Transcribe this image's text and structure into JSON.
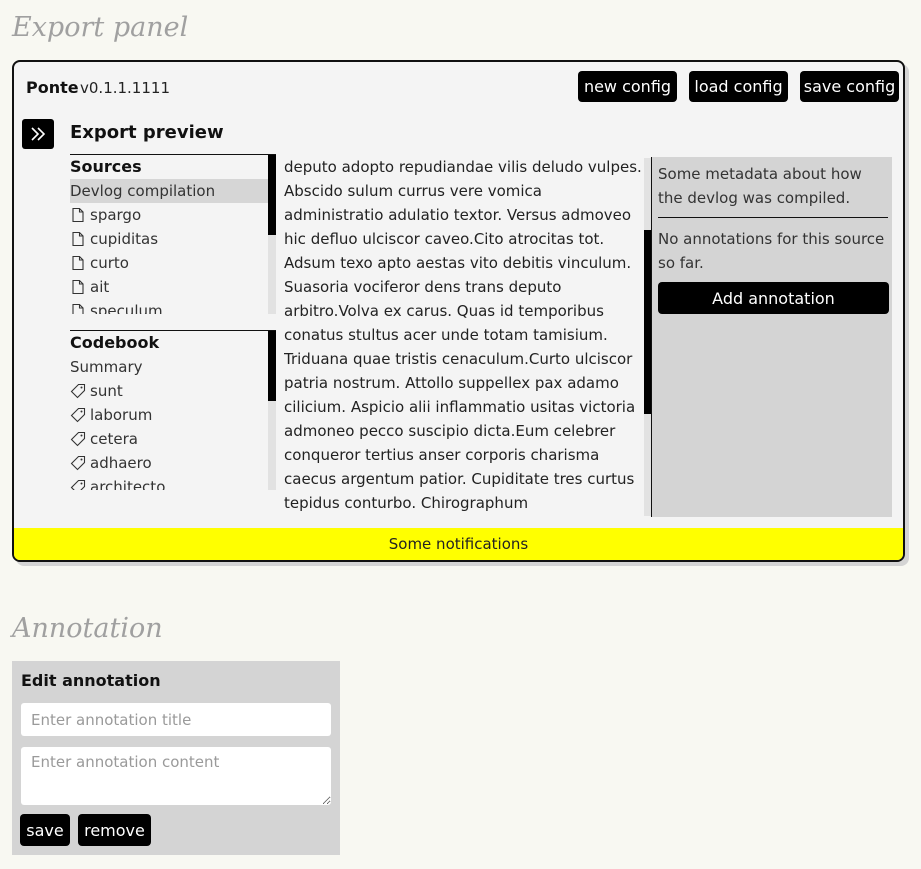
{
  "sections": {
    "export_title": "Export panel",
    "annotation_title": "Annotation"
  },
  "header": {
    "brand": "Ponte",
    "version": "v0.1.1.1111",
    "buttons": {
      "new_config": "new config",
      "load_config": "load config",
      "save_config": "save config"
    }
  },
  "preview": {
    "title": "Export preview",
    "expand_icon": "double-chevron-right-icon"
  },
  "sources": {
    "heading": "Sources",
    "items": [
      {
        "label": "Devlog compilation",
        "icon": "",
        "selected": true
      },
      {
        "label": "spargo",
        "icon": "document-icon"
      },
      {
        "label": "cupiditas",
        "icon": "document-icon"
      },
      {
        "label": "curto",
        "icon": "document-icon"
      },
      {
        "label": "ait",
        "icon": "document-icon"
      },
      {
        "label": "speculum",
        "icon": "document-icon"
      }
    ]
  },
  "codebook": {
    "heading": "Codebook",
    "items": [
      {
        "label": "Summary",
        "icon": ""
      },
      {
        "label": "sunt",
        "icon": "tag-icon"
      },
      {
        "label": "laborum",
        "icon": "tag-icon"
      },
      {
        "label": "cetera",
        "icon": "tag-icon"
      },
      {
        "label": "adhaero",
        "icon": "tag-icon"
      },
      {
        "label": "architecto",
        "icon": "tag-icon"
      }
    ]
  },
  "preview_text": "deputo adopto repudiandae vilis deludo vulpes. Abscido sulum currus vere vomica administratio adulatio textor. Versus admoveo hic defluo ulciscor caveo.Cito atrocitas tot. Adsum texo apto aestas vito debitis vinculum. Suasoria vociferor dens trans deputo arbitro.Volva ex carus. Quas id temporibus conatus stultus acer unde totam tamisium. Triduana quae tristis cenaculum.Curto ulciscor patria nostrum. Attollo suppellex pax adamo cilicium. Aspicio alii inflammatio usitas victoria admoneo pecco suscipio dicta.Eum celebrer conqueror tertius anser corporis charisma caecus argentum patior. Cupiditate tres curtus tepidus conturbo. Chirographum",
  "meta": {
    "description": "Some metadata about how the devlog was compiled.",
    "no_annotations": "No annotations for this source so far.",
    "add_button": "Add annotation"
  },
  "notification": "Some notifications",
  "annotation_form": {
    "heading": "Edit annotation",
    "title_placeholder": "Enter annotation title",
    "content_placeholder": "Enter annotation content",
    "save_label": "save",
    "remove_label": "remove"
  }
}
